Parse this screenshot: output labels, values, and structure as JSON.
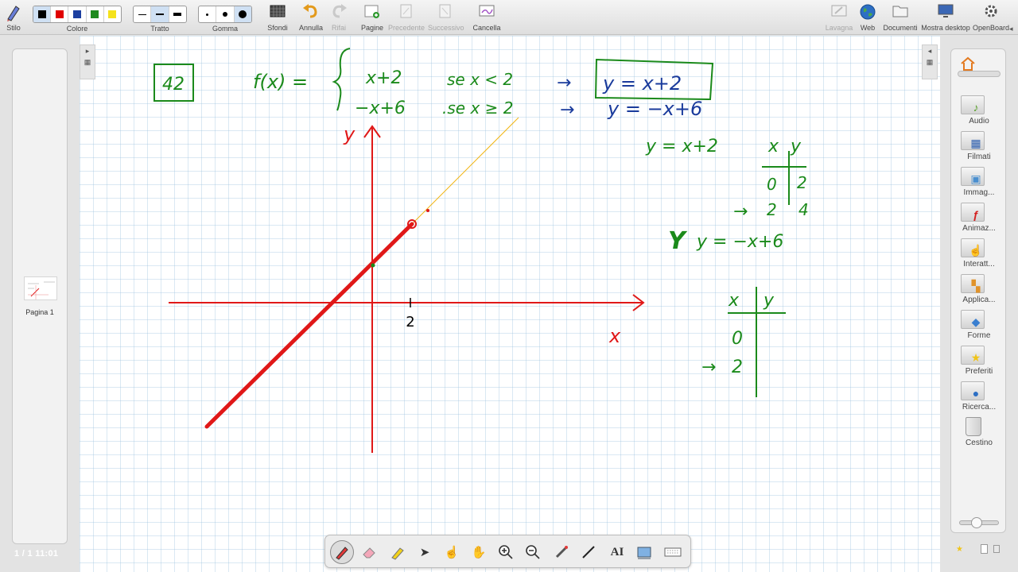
{
  "toolbar": {
    "stylus": "Stilo",
    "colors_label": "Colore",
    "colors": [
      "#000000",
      "#e00000",
      "#1c3fa0",
      "#1e8a1e",
      "#f5e21b"
    ],
    "stroke_label": "Tratto",
    "eraser_label": "Gomma",
    "backgrounds": "Sfondi",
    "undo": "Annulla",
    "redo": "Rifai",
    "pages": "Pagine",
    "previous": "Precedente",
    "next": "Successivo",
    "clear": "Cancella",
    "board": "Lavagna",
    "web": "Web",
    "documents": "Documenti",
    "show_desktop": "Mostra desktop",
    "openboard": "OpenBoard",
    "corner_arrow": "◂"
  },
  "pages_panel": {
    "thumbnail_label": "Pagina 1",
    "status": "1 / 1   11:01"
  },
  "library": {
    "items": [
      {
        "label": "Audio",
        "icon": "speaker-icon"
      },
      {
        "label": "Filmati",
        "icon": "film-icon"
      },
      {
        "label": "Immag...",
        "icon": "image-icon"
      },
      {
        "label": "Animaz...",
        "icon": "flash-icon"
      },
      {
        "label": "Interatt...",
        "icon": "hand-icon"
      },
      {
        "label": "Applica...",
        "icon": "apps-icon"
      },
      {
        "label": "Forme",
        "icon": "shapes-icon"
      },
      {
        "label": "Preferiti",
        "icon": "star-icon"
      },
      {
        "label": "Ricerca...",
        "icon": "globe-icon"
      },
      {
        "label": "Cestino",
        "icon": "trash-icon"
      }
    ]
  },
  "board": {
    "exercise_number": "42",
    "function_def": "f(x) =",
    "branch1_expr": "x+2",
    "branch1_cond": "se  x < 2",
    "branch1_result": "y = x+2",
    "branch2_expr": "−x+6",
    "branch2_cond": ".se  x ≥ 2",
    "branch2_result": "y = −x+6",
    "table1_equation": "y = x+2",
    "table1_x_header": "x",
    "table1_y_header": "y",
    "table1_rows": [
      [
        "0",
        "2"
      ],
      [
        "2",
        "4"
      ]
    ],
    "eq2": "y = −x+6",
    "table2_x_header": "x",
    "table2_y_header": "y",
    "table2_rows": [
      "0",
      "2"
    ],
    "axis_y_label": "y",
    "axis_x_label": "x",
    "tick_label": "2",
    "arrow": "→",
    "colors": {
      "red": "#e01818",
      "green": "#1b8a1b",
      "blue": "#1a3b9c",
      "yellow": "#f1b512"
    }
  }
}
